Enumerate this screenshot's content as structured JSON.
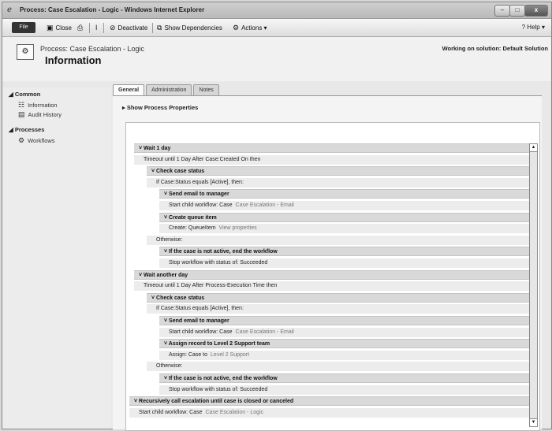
{
  "window": {
    "title": "Process: Case Escalation - Logic - Windows Internet Explorer",
    "min": "–",
    "max": "□",
    "close": "x"
  },
  "ribbon": {
    "file": "File",
    "close": "Close",
    "deactivate": "Deactivate",
    "show_dependencies": "Show Dependencies",
    "actions": "Actions ▾",
    "help": "Help ▾"
  },
  "header": {
    "entity_line": "Process: Case Escalation - Logic",
    "title": "Information",
    "solution": "Working on solution: Default Solution"
  },
  "nav": {
    "common_heading": "◢ Common",
    "information": "Information",
    "audit_history": "Audit History",
    "processes_heading": "◢ Processes",
    "workflows": "Workflows"
  },
  "tabs": [
    "General",
    "Administration",
    "Notes"
  ],
  "show_process_properties": "▸ Show Process Properties",
  "steps": [
    {
      "text": "˅ Wait 1 day",
      "kind": "step"
    },
    {
      "text": "Timeout until 1 Day After Case:Created On then",
      "kind": "plain"
    },
    {
      "text": "˅ Check case status",
      "kind": "step"
    },
    {
      "text": "If Case:Status equals [Active], then:",
      "kind": "plain"
    },
    {
      "text": "˅ Send email to manager",
      "kind": "step"
    },
    {
      "text": "Start child workflow: Case",
      "extra": "Case Escalation - Email",
      "kind": "plain"
    },
    {
      "text": "˅ Create queue item",
      "kind": "step"
    },
    {
      "text": "Create: QueueItem",
      "extra": "View properties",
      "kind": "plain"
    },
    {
      "text": "Otherwise:",
      "kind": "plain"
    },
    {
      "text": "˅ If the case is not active, end the workflow",
      "kind": "step"
    },
    {
      "text": "Stop workflow with status of: Succeeded",
      "kind": "plain"
    },
    {
      "text": "˅ Wait another day",
      "kind": "step"
    },
    {
      "text": "Timeout until 1 Day After Process-Execution Time then",
      "kind": "plain"
    },
    {
      "text": "˅ Check case status",
      "kind": "step"
    },
    {
      "text": "If Case:Status equals [Active], then:",
      "kind": "plain"
    },
    {
      "text": "˅ Send email to manager",
      "kind": "step"
    },
    {
      "text": "Start child workflow: Case",
      "extra": "Case Escalation - Email",
      "kind": "plain"
    },
    {
      "text": "˅ Assign record to Level 2 Support team",
      "kind": "step"
    },
    {
      "text": "Assign: Case to",
      "extra": "Level 2 Support",
      "kind": "plain"
    },
    {
      "text": "Otherwise:",
      "kind": "plain"
    },
    {
      "text": "˅ If the case is not active, end the workflow",
      "kind": "step"
    },
    {
      "text": "Stop workflow with status of: Succeeded",
      "kind": "plain"
    },
    {
      "text": "˅ Recursively call escalation until case is closed or canceled",
      "kind": "step"
    },
    {
      "text": "Start child workflow: Case",
      "extra": "Case Escalation - Logic",
      "kind": "plain"
    }
  ]
}
